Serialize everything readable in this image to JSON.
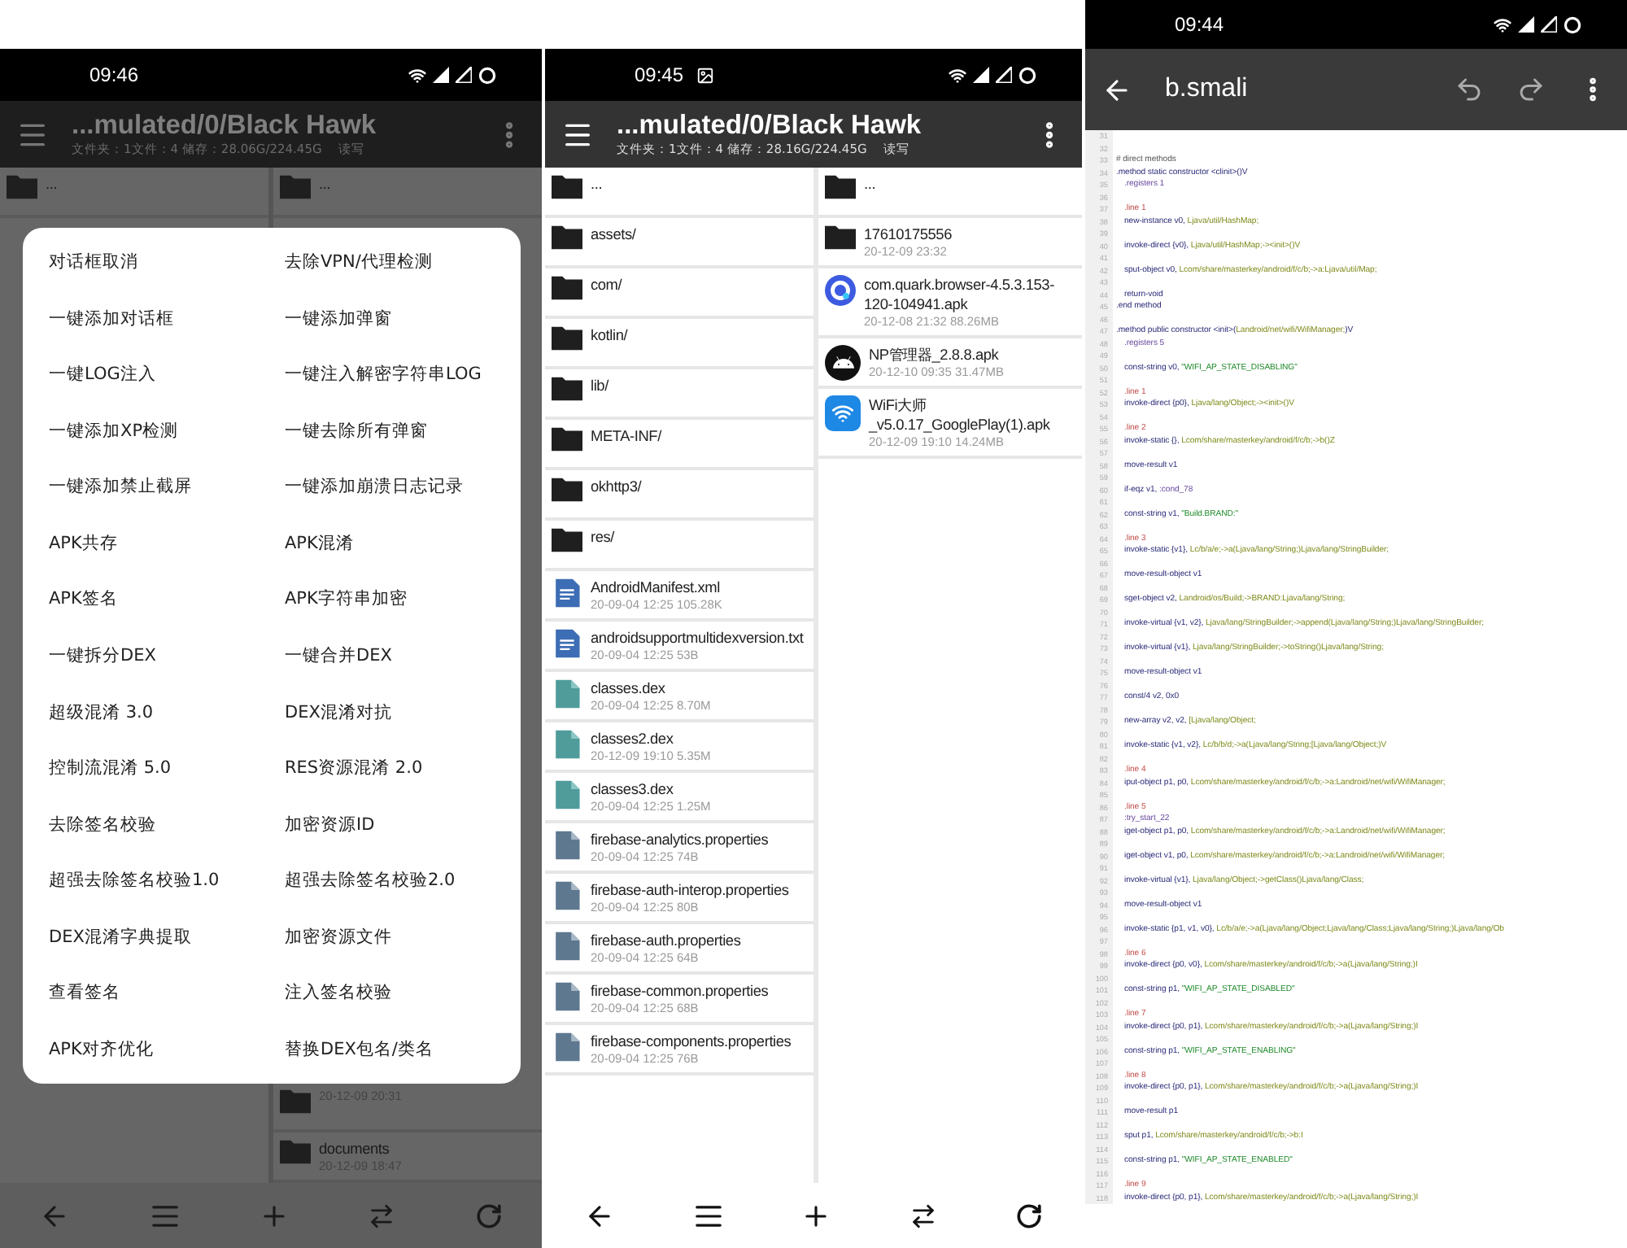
{
  "screens": [
    {
      "kind": "file-manager",
      "status": {
        "time": "09:46"
      },
      "toolbar": {
        "title": "...mulated/0/Black Hawk",
        "subtitle": "文件夹：1文件：4 储存：28.06G/224.45G",
        "mode": "读写"
      },
      "left_pane": {
        "items": [
          {
            "kind": "folder",
            "name": "..."
          }
        ]
      },
      "right_pane": {
        "items": [
          {
            "kind": "folder",
            "name": "..."
          }
        ],
        "bottom_items": [
          {
            "kind": "folder",
            "meta": "20-12-09 20:31"
          },
          {
            "kind": "folder",
            "name": "documents",
            "meta": "20-12-09 18:47"
          }
        ]
      },
      "dialog": {
        "items": [
          "对话框取消",
          "去除VPN/代理检测",
          "一键添加对话框",
          "一键添加弹窗",
          "一键LOG注入",
          "一键注入解密字符串LOG",
          "一键添加XP检测",
          "一键去除所有弹窗",
          "一键添加禁止截屏",
          "一键添加崩溃日志记录",
          "APK共存",
          "APK混淆",
          "APK签名",
          "APK字符串加密",
          "一键拆分DEX",
          "一键合并DEX",
          "超级混淆 3.0",
          "DEX混淆对抗",
          "控制流混淆 5.0",
          "RES资源混淆 2.0",
          "去除签名校验",
          "加密资源ID",
          "超强去除签名校验1.0",
          "超强去除签名校验2.0",
          "DEX混淆字典提取",
          "加密资源文件",
          "查看签名",
          "注入签名校验",
          "APK对齐优化",
          "替换DEX包名/类名"
        ]
      }
    },
    {
      "kind": "file-manager",
      "status": {
        "time": "09:45",
        "photo_notification": true
      },
      "toolbar": {
        "title": "...mulated/0/Black Hawk",
        "subtitle": "文件夹：1文件：4 储存：28.16G/224.45G",
        "mode": "读写"
      },
      "left_pane": {
        "items": [
          {
            "kind": "folder",
            "name": "..."
          },
          {
            "kind": "folder",
            "name": "assets/"
          },
          {
            "kind": "folder",
            "name": "com/"
          },
          {
            "kind": "folder",
            "name": "kotlin/"
          },
          {
            "kind": "folder",
            "name": "lib/"
          },
          {
            "kind": "folder",
            "name": "META-INF/"
          },
          {
            "kind": "folder",
            "name": "okhttp3/"
          },
          {
            "kind": "folder",
            "name": "res/"
          },
          {
            "kind": "document",
            "name": "AndroidManifest.xml",
            "meta": "20-09-04 12:25 105.28K"
          },
          {
            "kind": "document",
            "name": "androidsupportmultidexversion.txt",
            "meta": "20-09-04 12:25 53B"
          },
          {
            "kind": "dex",
            "name": "classes.dex",
            "meta": "20-09-04 12:25 8.70M"
          },
          {
            "kind": "dex",
            "name": "classes2.dex",
            "meta": "20-12-09 19:10 5.35M"
          },
          {
            "kind": "dex",
            "name": "classes3.dex",
            "meta": "20-09-04 12:25 1.25M"
          },
          {
            "kind": "properties",
            "name": "firebase-analytics.properties",
            "meta": "20-09-04 12:25 74B"
          },
          {
            "kind": "properties",
            "name": "firebase-auth-interop.properties",
            "meta": "20-09-04 12:25 80B"
          },
          {
            "kind": "properties",
            "name": "firebase-auth.properties",
            "meta": "20-09-04 12:25 64B"
          },
          {
            "kind": "properties",
            "name": "firebase-common.properties",
            "meta": "20-09-04 12:25 68B"
          },
          {
            "kind": "properties",
            "name": "firebase-components.properties",
            "meta": "20-09-04 12:25 76B"
          }
        ]
      },
      "right_pane": {
        "items": [
          {
            "kind": "folder",
            "name": "..."
          },
          {
            "kind": "folder",
            "name": "17610175556",
            "meta": "20-12-09 23:32"
          },
          {
            "kind": "quark-app",
            "name": "com.quark.browser-4.5.3.153-120-104941.apk",
            "meta": "20-12-08 21:32 88.26MB"
          },
          {
            "kind": "android-app",
            "name": "NP管理器_2.8.8.apk",
            "meta": "20-12-10 09:35 31.47MB"
          },
          {
            "kind": "wifi-app",
            "name": "WiFi大师_v5.0.17_GooglePlay(1).apk",
            "meta": "20-12-09 19:10 14.24MB"
          }
        ]
      }
    },
    {
      "kind": "editor",
      "status": {
        "time": "09:44"
      },
      "toolbar": {
        "title": "b.smali"
      },
      "lines": [
        {
          "n": "31"
        },
        {
          "n": "32"
        },
        {
          "n": "33",
          "indent": false,
          "code": [
            {
              "kind": "comment",
              "text": "# direct methods"
            }
          ]
        },
        {
          "n": "34",
          "indent": false,
          "code": [
            {
              "kind": "op",
              "text": ".method static constructor <clinit>()V"
            }
          ]
        },
        {
          "n": "35",
          "indent": true,
          "code": [
            {
              "kind": "dir",
              "text": ".registers 1"
            }
          ]
        },
        {
          "n": "36"
        },
        {
          "n": "37",
          "indent": true,
          "code": [
            {
              "kind": "line",
              "text": ".line 1"
            }
          ]
        },
        {
          "n": "38",
          "indent": true,
          "code": [
            {
              "kind": "op",
              "text": "new-instance v0, "
            },
            {
              "kind": "ref",
              "text": "Ljava/util/HashMap;"
            }
          ]
        },
        {
          "n": "39"
        },
        {
          "n": "40",
          "indent": true,
          "code": [
            {
              "kind": "op",
              "text": "invoke-direct {v0}, "
            },
            {
              "kind": "ref",
              "text": "Ljava/util/HashMap;-><init>()V"
            }
          ]
        },
        {
          "n": "41"
        },
        {
          "n": "42",
          "indent": true,
          "code": [
            {
              "kind": "op",
              "text": "sput-object v0, "
            },
            {
              "kind": "ref",
              "text": "Lcom/share/masterkey/android/f/c/b;->a:Ljava/util/Map;"
            }
          ]
        },
        {
          "n": "43"
        },
        {
          "n": "44",
          "indent": true,
          "code": [
            {
              "kind": "op",
              "text": "return-void"
            }
          ]
        },
        {
          "n": "45",
          "indent": false,
          "code": [
            {
              "kind": "op",
              "text": ".end method"
            }
          ]
        },
        {
          "n": "46"
        },
        {
          "n": "47",
          "indent": false,
          "code": [
            {
              "kind": "op",
              "text": ".method public constructor <init>("
            },
            {
              "kind": "ref",
              "text": "Landroid/net/wifi/WifiManager;"
            },
            {
              "kind": "op",
              "text": ")V"
            }
          ]
        },
        {
          "n": "48",
          "indent": true,
          "code": [
            {
              "kind": "dir",
              "text": ".registers 5"
            }
          ]
        },
        {
          "n": "49"
        },
        {
          "n": "50",
          "indent": true,
          "code": [
            {
              "kind": "op",
              "text": "const-string v0, "
            },
            {
              "kind": "str",
              "text": "\"WIFI_AP_STATE_DISABLING\""
            }
          ]
        },
        {
          "n": "51"
        },
        {
          "n": "52",
          "indent": true,
          "code": [
            {
              "kind": "line",
              "text": ".line 1"
            }
          ]
        },
        {
          "n": "53",
          "indent": true,
          "code": [
            {
              "kind": "op",
              "text": "invoke-direct {p0}, "
            },
            {
              "kind": "ref",
              "text": "Ljava/lang/Object;-><init>()V"
            }
          ]
        },
        {
          "n": "54"
        },
        {
          "n": "55",
          "indent": true,
          "code": [
            {
              "kind": "line",
              "text": ".line 2"
            }
          ]
        },
        {
          "n": "56",
          "indent": true,
          "code": [
            {
              "kind": "op",
              "text": "invoke-static {}, "
            },
            {
              "kind": "ref",
              "text": "Lcom/share/masterkey/android/f/c/b;->b()Z"
            }
          ]
        },
        {
          "n": "57"
        },
        {
          "n": "58",
          "indent": true,
          "code": [
            {
              "kind": "op",
              "text": "move-result v1"
            }
          ]
        },
        {
          "n": "59"
        },
        {
          "n": "60",
          "indent": true,
          "code": [
            {
              "kind": "op",
              "text": "if-eqz v1, "
            },
            {
              "kind": "dir",
              "text": ":cond_78"
            }
          ]
        },
        {
          "n": "61"
        },
        {
          "n": "62",
          "indent": true,
          "code": [
            {
              "kind": "op",
              "text": "const-string v1, "
            },
            {
              "kind": "str",
              "text": "\"Build.BRAND:\""
            }
          ]
        },
        {
          "n": "63"
        },
        {
          "n": "64",
          "indent": true,
          "code": [
            {
              "kind": "line",
              "text": ".line 3"
            }
          ]
        },
        {
          "n": "65",
          "indent": true,
          "code": [
            {
              "kind": "op",
              "text": "invoke-static {v1}, "
            },
            {
              "kind": "ref",
              "text": "Lc/b/a/e;->a(Ljava/lang/String;)Ljava/lang/StringBuilder;"
            }
          ]
        },
        {
          "n": "66"
        },
        {
          "n": "67",
          "indent": true,
          "code": [
            {
              "kind": "op",
              "text": "move-result-object v1"
            }
          ]
        },
        {
          "n": "68"
        },
        {
          "n": "69",
          "indent": true,
          "code": [
            {
              "kind": "op",
              "text": "sget-object v2, "
            },
            {
              "kind": "ref",
              "text": "Landroid/os/Build;->BRAND:Ljava/lang/String;"
            }
          ]
        },
        {
          "n": "70"
        },
        {
          "n": "71",
          "indent": true,
          "code": [
            {
              "kind": "op",
              "text": "invoke-virtual {v1, v2}, "
            },
            {
              "kind": "ref",
              "text": "Ljava/lang/StringBuilder;->append(Ljava/lang/String;)Ljava/lang/StringBuilder;"
            }
          ]
        },
        {
          "n": "72"
        },
        {
          "n": "73",
          "indent": true,
          "code": [
            {
              "kind": "op",
              "text": "invoke-virtual {v1}, "
            },
            {
              "kind": "ref",
              "text": "Ljava/lang/StringBuilder;->toString()Ljava/lang/String;"
            }
          ]
        },
        {
          "n": "74"
        },
        {
          "n": "75",
          "indent": true,
          "code": [
            {
              "kind": "op",
              "text": "move-result-object v1"
            }
          ]
        },
        {
          "n": "76"
        },
        {
          "n": "77",
          "indent": true,
          "code": [
            {
              "kind": "op",
              "text": "const/4 v2, 0x0"
            }
          ]
        },
        {
          "n": "78"
        },
        {
          "n": "79",
          "indent": true,
          "code": [
            {
              "kind": "op",
              "text": "new-array v2, v2, "
            },
            {
              "kind": "ref",
              "text": "[Ljava/lang/Object;"
            }
          ]
        },
        {
          "n": "80"
        },
        {
          "n": "81",
          "indent": true,
          "code": [
            {
              "kind": "op",
              "text": "invoke-static {v1, v2}, "
            },
            {
              "kind": "ref",
              "text": "Lc/b/b/d;->a(Ljava/lang/String;[Ljava/lang/Object;)V"
            }
          ]
        },
        {
          "n": "82"
        },
        {
          "n": "83",
          "indent": true,
          "code": [
            {
              "kind": "line",
              "text": ".line 4"
            }
          ]
        },
        {
          "n": "84",
          "indent": true,
          "code": [
            {
              "kind": "op",
              "text": "iput-object p1, p0, "
            },
            {
              "kind": "ref",
              "text": "Lcom/share/masterkey/android/f/c/b;->a:Landroid/net/wifi/WifiManager;"
            }
          ]
        },
        {
          "n": "85"
        },
        {
          "n": "86",
          "indent": true,
          "code": [
            {
              "kind": "line",
              "text": ".line 5"
            }
          ]
        },
        {
          "n": "87",
          "indent": true,
          "code": [
            {
              "kind": "dir",
              "text": ":try_start_22"
            }
          ]
        },
        {
          "n": "88",
          "indent": true,
          "code": [
            {
              "kind": "op",
              "text": "iget-object p1, p0, "
            },
            {
              "kind": "ref",
              "text": "Lcom/share/masterkey/android/f/c/b;->a:Landroid/net/wifi/WifiManager;"
            }
          ]
        },
        {
          "n": "89"
        },
        {
          "n": "90",
          "indent": true,
          "code": [
            {
              "kind": "op",
              "text": "iget-object v1, p0, "
            },
            {
              "kind": "ref",
              "text": "Lcom/share/masterkey/android/f/c/b;->a:Landroid/net/wifi/WifiManager;"
            }
          ]
        },
        {
          "n": "91"
        },
        {
          "n": "92",
          "indent": true,
          "code": [
            {
              "kind": "op",
              "text": "invoke-virtual {v1}, "
            },
            {
              "kind": "ref",
              "text": "Ljava/lang/Object;->getClass()Ljava/lang/Class;"
            }
          ]
        },
        {
          "n": "93"
        },
        {
          "n": "94",
          "indent": true,
          "code": [
            {
              "kind": "op",
              "text": "move-result-object v1"
            }
          ]
        },
        {
          "n": "95"
        },
        {
          "n": "96",
          "indent": true,
          "code": [
            {
              "kind": "op",
              "text": "invoke-static {p1, v1, v0}, "
            },
            {
              "kind": "ref",
              "text": "Lc/b/a/e;->a(Ljava/lang/Object;Ljava/lang/Class;Ljava/lang/String;)Ljava/lang/Ob"
            }
          ]
        },
        {
          "n": "97"
        },
        {
          "n": "98",
          "indent": true,
          "code": [
            {
              "kind": "line",
              "text": ".line 6"
            }
          ]
        },
        {
          "n": "99",
          "indent": true,
          "code": [
            {
              "kind": "op",
              "text": "invoke-direct {p0, v0}, "
            },
            {
              "kind": "ref",
              "text": "Lcom/share/masterkey/android/f/c/b;->a(Ljava/lang/String;)I"
            }
          ]
        },
        {
          "n": "100"
        },
        {
          "n": "101",
          "indent": true,
          "code": [
            {
              "kind": "op",
              "text": "const-string p1, "
            },
            {
              "kind": "str",
              "text": "\"WIFI_AP_STATE_DISABLED\""
            }
          ]
        },
        {
          "n": "102"
        },
        {
          "n": "103",
          "indent": true,
          "code": [
            {
              "kind": "line",
              "text": ".line 7"
            }
          ]
        },
        {
          "n": "104",
          "indent": true,
          "code": [
            {
              "kind": "op",
              "text": "invoke-direct {p0, p1}, "
            },
            {
              "kind": "ref",
              "text": "Lcom/share/masterkey/android/f/c/b;->a(Ljava/lang/String;)I"
            }
          ]
        },
        {
          "n": "105"
        },
        {
          "n": "106",
          "indent": true,
          "code": [
            {
              "kind": "op",
              "text": "const-string p1, "
            },
            {
              "kind": "str",
              "text": "\"WIFI_AP_STATE_ENABLING\""
            }
          ]
        },
        {
          "n": "107"
        },
        {
          "n": "108",
          "indent": true,
          "code": [
            {
              "kind": "line",
              "text": ".line 8"
            }
          ]
        },
        {
          "n": "109",
          "indent": true,
          "code": [
            {
              "kind": "op",
              "text": "invoke-direct {p0, p1}, "
            },
            {
              "kind": "ref",
              "text": "Lcom/share/masterkey/android/f/c/b;->a(Ljava/lang/String;)I"
            }
          ]
        },
        {
          "n": "110"
        },
        {
          "n": "111",
          "indent": true,
          "code": [
            {
              "kind": "op",
              "text": "move-result p1"
            }
          ]
        },
        {
          "n": "112"
        },
        {
          "n": "113",
          "indent": true,
          "code": [
            {
              "kind": "op",
              "text": "sput p1, "
            },
            {
              "kind": "ref",
              "text": "Lcom/share/masterkey/android/f/c/b;->b:I"
            }
          ]
        },
        {
          "n": "114"
        },
        {
          "n": "115",
          "indent": true,
          "code": [
            {
              "kind": "op",
              "text": "const-string p1, "
            },
            {
              "kind": "str",
              "text": "\"WIFI_AP_STATE_ENABLED\""
            }
          ]
        },
        {
          "n": "116"
        },
        {
          "n": "117",
          "indent": true,
          "code": [
            {
              "kind": "line",
              "text": ".line 9"
            }
          ]
        },
        {
          "n": "118",
          "indent": true,
          "code": [
            {
              "kind": "op",
              "text": "invoke-direct {p0, p1}, "
            },
            {
              "kind": "ref",
              "text": "Lcom/share/masterkey/android/f/c/b;->a(Ljava/lang/String;)I"
            }
          ]
        }
      ]
    }
  ]
}
